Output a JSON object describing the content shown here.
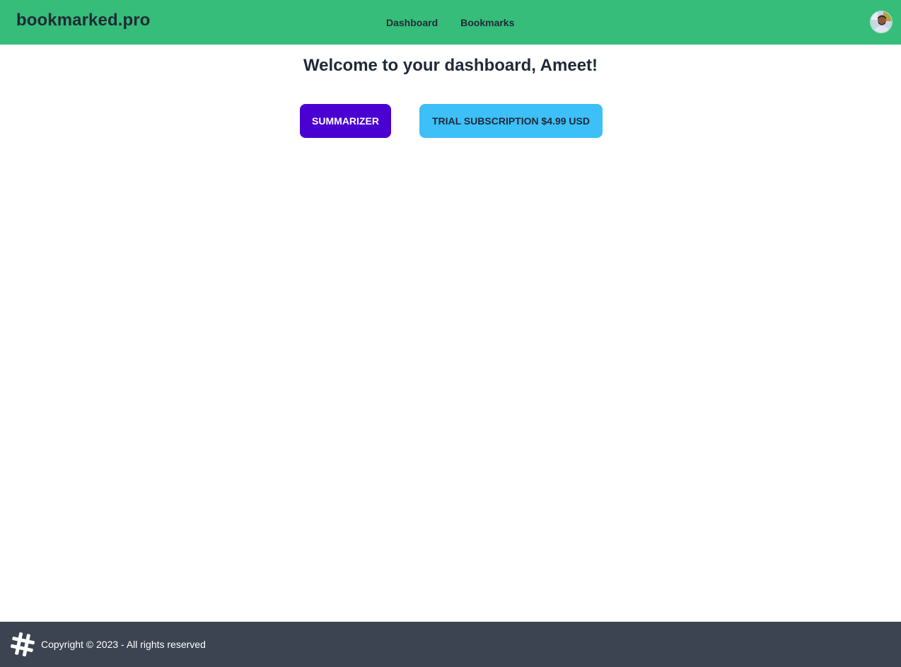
{
  "header": {
    "brand": "bookmarked.pro",
    "nav": [
      {
        "label": "Dashboard"
      },
      {
        "label": "Bookmarks"
      }
    ],
    "avatar_icon": "user-avatar"
  },
  "main": {
    "welcome": "Welcome to your dashboard, Ameet!",
    "summarizer_label": "SUMMARIZER",
    "trial_label": "TRIAL SUBSCRIPTION $4.99 USD"
  },
  "footer": {
    "logo_icon": "hash-logo-icon",
    "copyright": "Copyright © 2023 - All rights reserved"
  },
  "colors": {
    "header_bg": "#36bd79",
    "summarizer_bg": "#4a00d1",
    "trial_bg": "#3dbff8",
    "footer_bg": "#3d4451"
  }
}
